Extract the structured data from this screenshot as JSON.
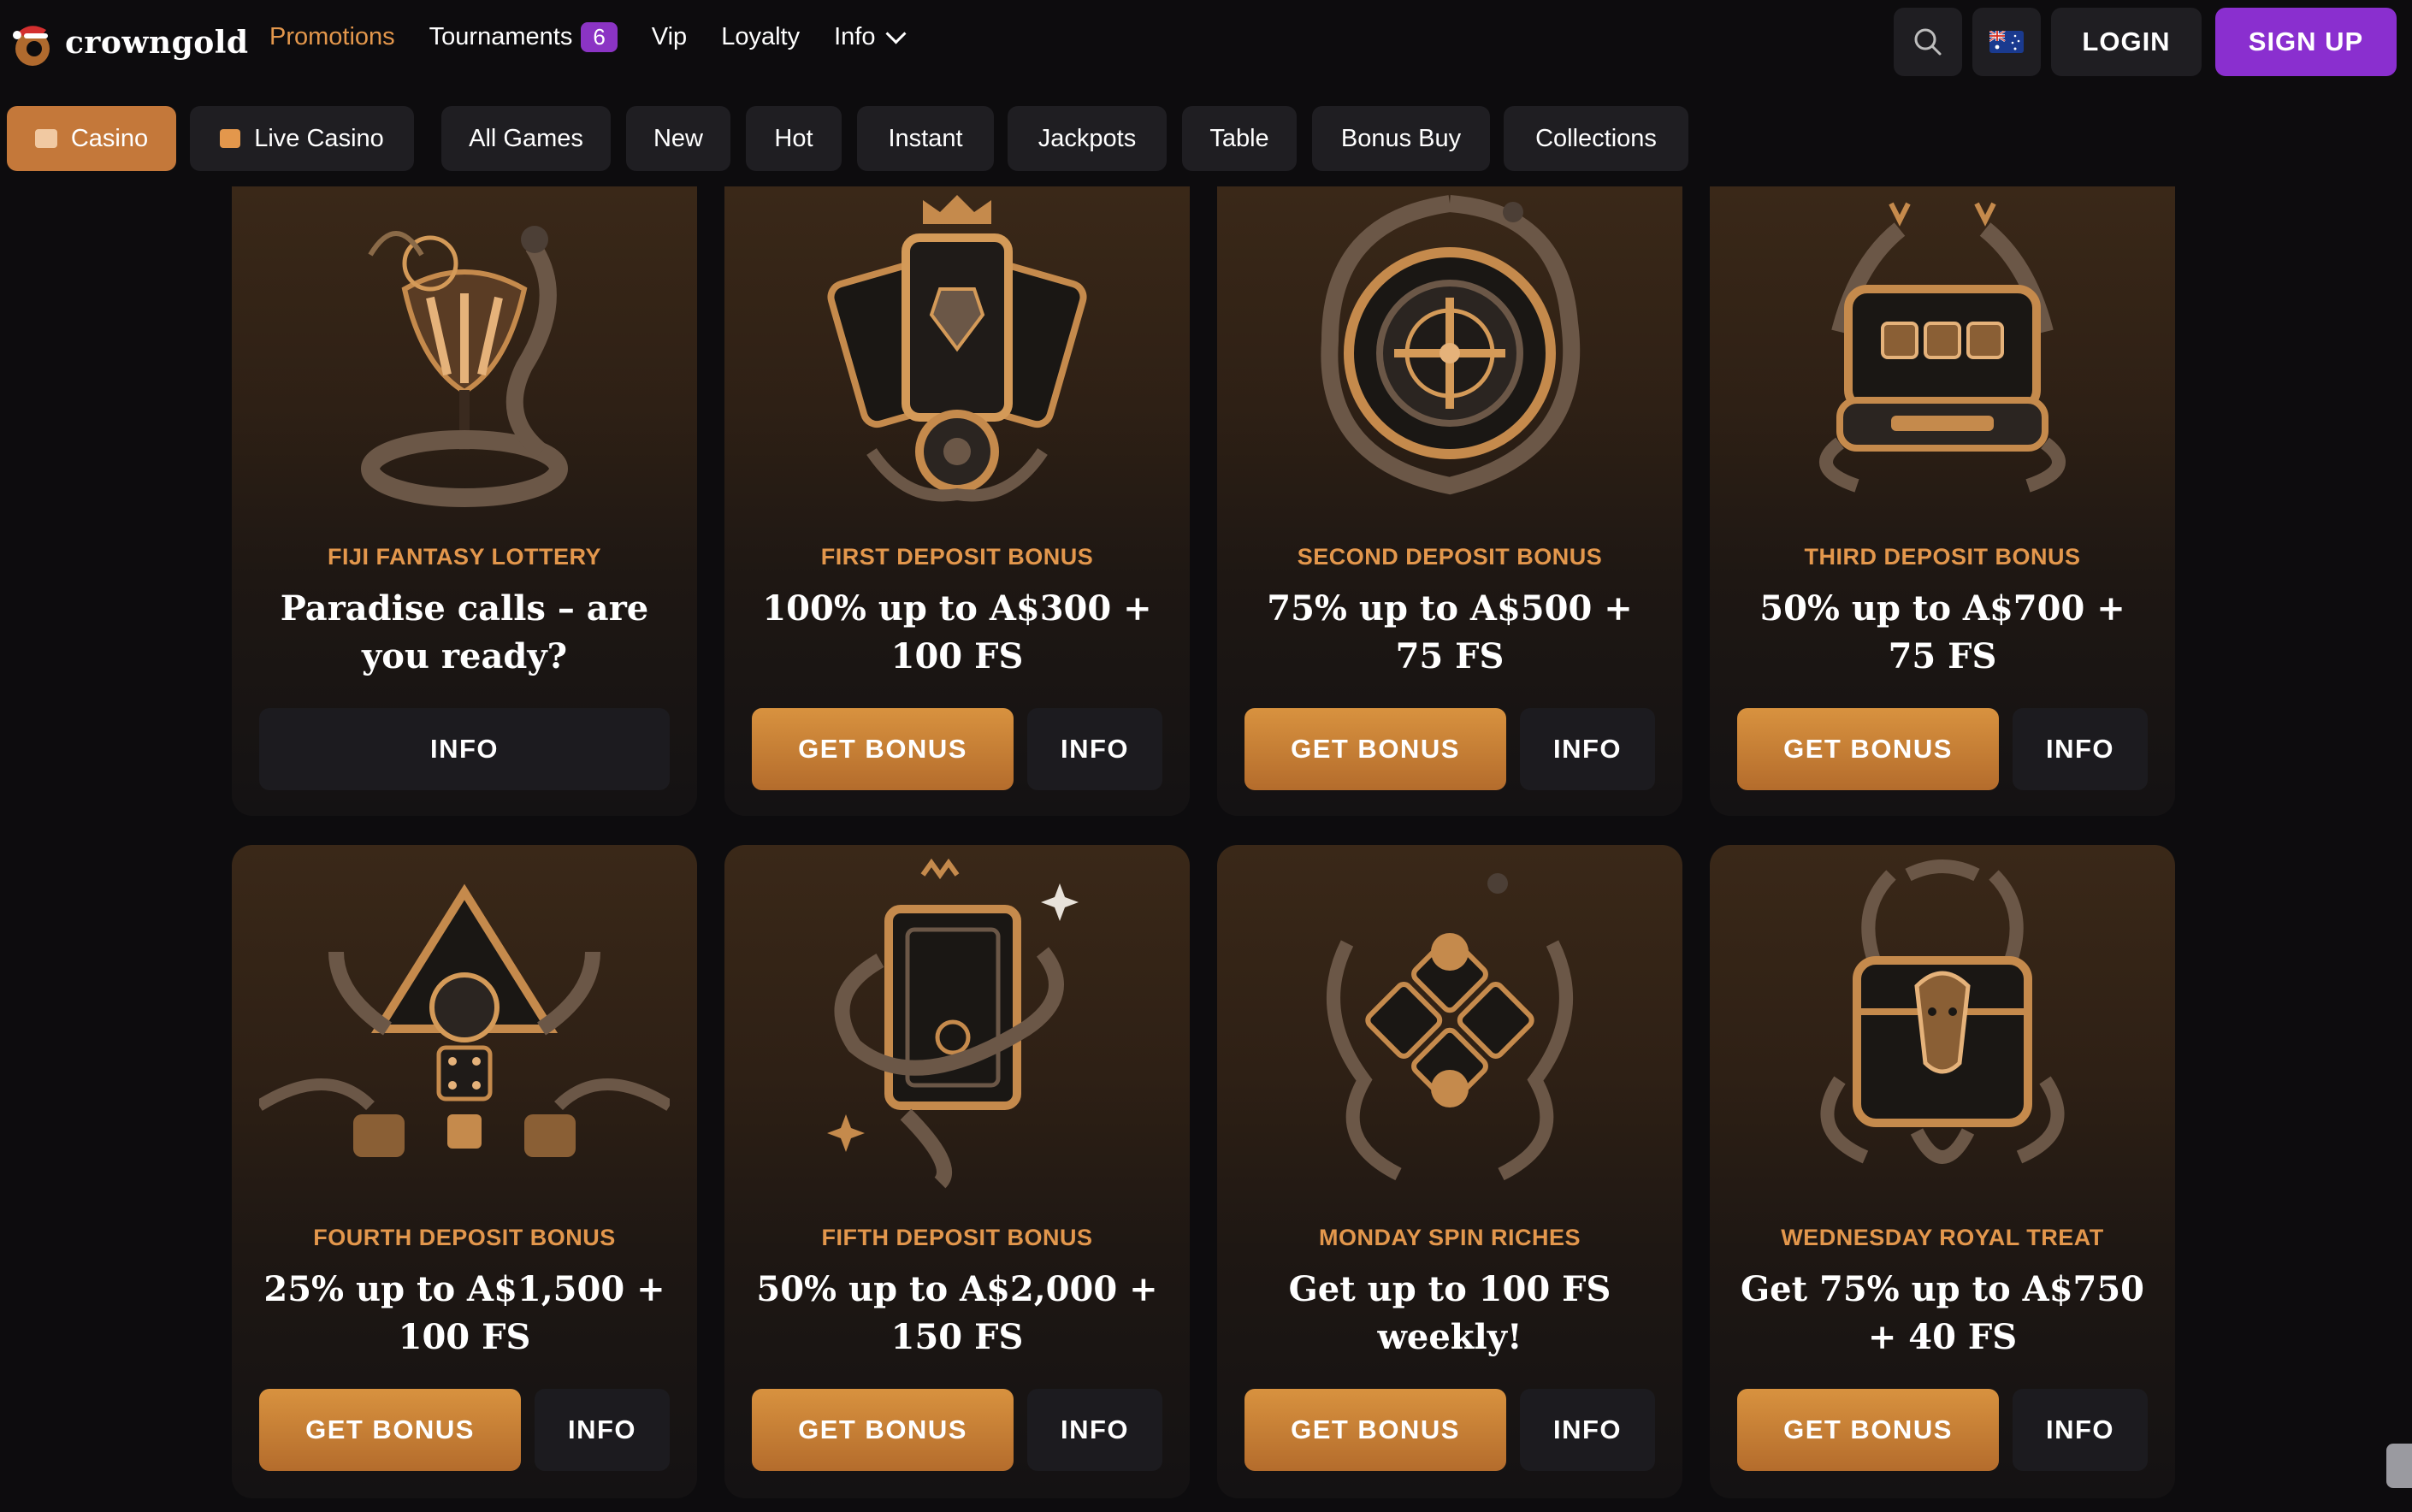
{
  "brand": {
    "name": "crowngold"
  },
  "nav": {
    "promotions": "Promotions",
    "tournaments": "Tournaments",
    "tournaments_count": "6",
    "vip": "Vip",
    "loyalty": "Loyalty",
    "info": "Info"
  },
  "header": {
    "login": "LOGIN",
    "signup": "SIGN UP"
  },
  "categories": [
    "Casino",
    "Live Casino",
    "All Games",
    "New",
    "Hot",
    "Instant",
    "Jackpots",
    "Table",
    "Bonus Buy",
    "Collections"
  ],
  "cards": [
    {
      "label": "FIJI FANTASY LOTTERY",
      "headline": "Paradise calls – are you ready?",
      "info": "INFO"
    },
    {
      "label": "FIRST DEPOSIT BONUS",
      "headline": "100% up to A$300 + 100 FS",
      "get": "GET BONUS",
      "info": "INFO"
    },
    {
      "label": "SECOND DEPOSIT BONUS",
      "headline": "75% up to A$500 + 75 FS",
      "get": "GET BONUS",
      "info": "INFO"
    },
    {
      "label": "THIRD DEPOSIT BONUS",
      "headline": "50% up to A$700 + 75 FS",
      "get": "GET BONUS",
      "info": "INFO"
    },
    {
      "label": "FOURTH DEPOSIT BONUS",
      "headline": "25% up to A$1,500 + 100 FS",
      "get": "GET BONUS",
      "info": "INFO"
    },
    {
      "label": "FIFTH DEPOSIT BONUS",
      "headline": "50% up to A$2,000 + 150 FS",
      "get": "GET BONUS",
      "info": "INFO"
    },
    {
      "label": "MONDAY SPIN RICHES",
      "headline": "Get up to 100 FS weekly!",
      "get": "GET BONUS",
      "info": "INFO"
    },
    {
      "label": "WEDNESDAY ROYAL TREAT",
      "headline": "Get 75% up to A$750 + 40 FS",
      "get": "GET BONUS",
      "info": "INFO"
    }
  ],
  "colors": {
    "accent": "#e3974c",
    "signup": "#8a2fcf",
    "button": "#c4783a",
    "background": "#0d0c0e"
  },
  "icons": [
    "santa-hat-icon",
    "search-icon",
    "australia-flag-icon",
    "casino-icon",
    "live-casino-icon",
    "chevron-down-icon"
  ]
}
